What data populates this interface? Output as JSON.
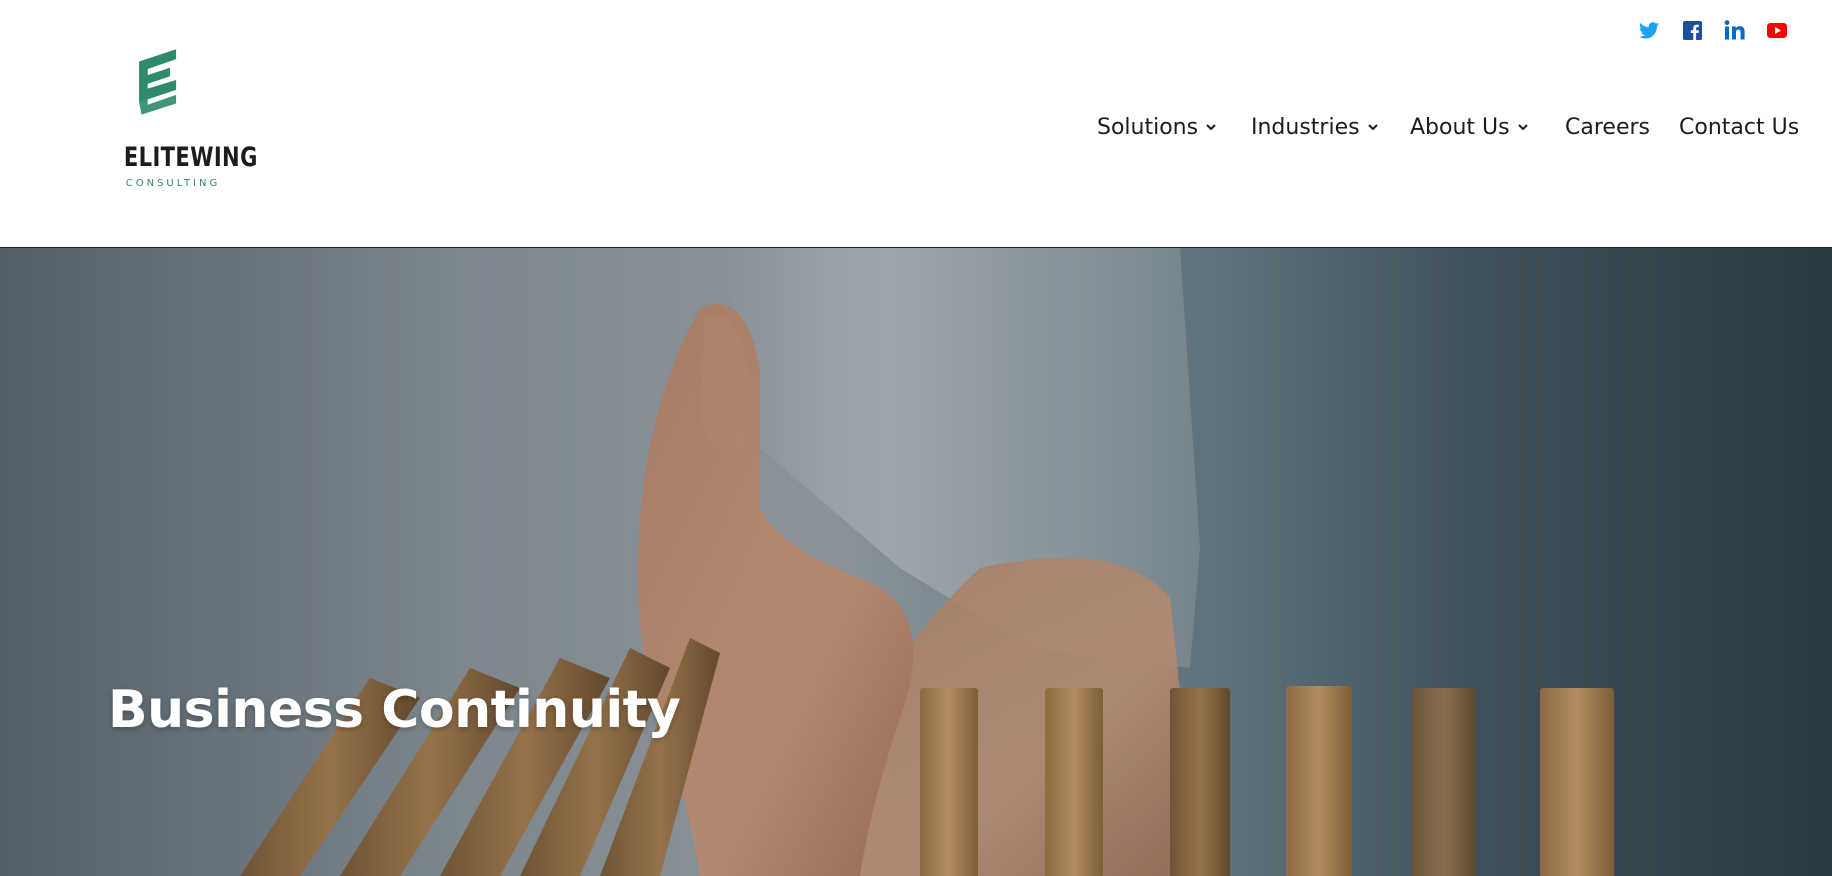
{
  "brand": {
    "name": "ELITEWING",
    "tagline": "CONSULTING",
    "accent_color": "#2f8a6c"
  },
  "social": [
    {
      "icon": "twitter-icon",
      "color": "#1da1f2"
    },
    {
      "icon": "facebook-icon",
      "color": "#1f4f9a"
    },
    {
      "icon": "linkedin-icon",
      "color": "#0a66c2"
    },
    {
      "icon": "youtube-icon",
      "color": "#ff0000"
    }
  ],
  "nav": {
    "items": [
      {
        "label": "Solutions",
        "has_dropdown": true
      },
      {
        "label": "Industries",
        "has_dropdown": true
      },
      {
        "label": "About Us",
        "has_dropdown": true
      },
      {
        "label": "Careers",
        "has_dropdown": false
      },
      {
        "label": "Contact Us",
        "has_dropdown": false
      }
    ]
  },
  "hero": {
    "title": "Business Continuity",
    "image": "hand-stopping-falling-dominoes"
  }
}
